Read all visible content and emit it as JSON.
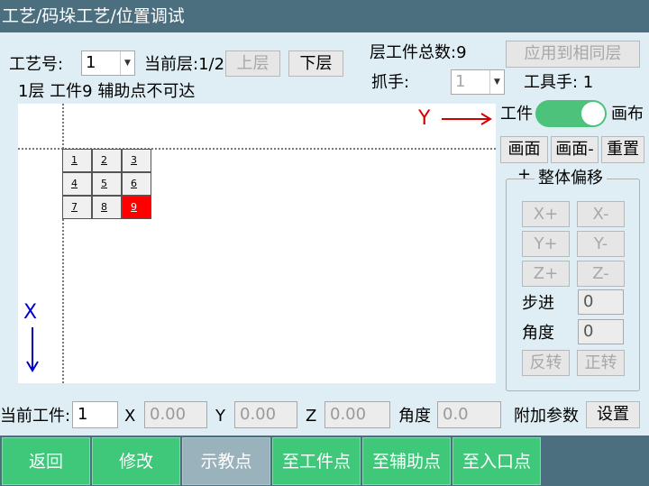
{
  "window": {
    "title": "工艺/码垛工艺/位置调试"
  },
  "header": {
    "process_label": "工艺号:",
    "process_value": "1",
    "current_layer_label": "当前层:1/2",
    "layer_up": "上层",
    "layer_down": "下层",
    "total_label": "层工件总数:9",
    "apply_same_layer": "应用到相同层",
    "gripper_label": "抓手:",
    "gripper_value": "1",
    "tool_label": "工具手: 1",
    "status_text": "1层 工件9 辅助点不可达"
  },
  "canvas": {
    "y_axis_label": "Y",
    "x_axis_label": "X",
    "cells": [
      {
        "label": "1",
        "selected": false
      },
      {
        "label": "2",
        "selected": false
      },
      {
        "label": "3",
        "selected": false
      },
      {
        "label": "4",
        "selected": false
      },
      {
        "label": "5",
        "selected": false
      },
      {
        "label": "6",
        "selected": false
      },
      {
        "label": "7",
        "selected": false
      },
      {
        "label": "8",
        "selected": false
      },
      {
        "label": "9",
        "selected": true
      }
    ]
  },
  "side": {
    "toggle_left": "工件",
    "toggle_right": "画布",
    "toggle_on": true,
    "zoom_in": "画面+",
    "zoom_out": "画面-",
    "reset": "重置",
    "offset_title": "整体偏移",
    "x_plus": "X+",
    "x_minus": "X-",
    "y_plus": "Y+",
    "y_minus": "Y-",
    "z_plus": "Z+",
    "z_minus": "Z-",
    "step_label": "步进",
    "step_value": "0",
    "angle_label": "角度",
    "angle_value": "0",
    "reverse": "反转",
    "forward": "正转"
  },
  "bottom_fields": {
    "current_label": "当前工件:",
    "current_value": "1",
    "x_label": "X",
    "x_value": "0.00",
    "y_label": "Y",
    "y_value": "0.00",
    "z_label": "Z",
    "z_value": "0.00",
    "angle_label": "角度",
    "angle_value": "0.0",
    "extra_label": "附加参数",
    "settings": "设置"
  },
  "nav": {
    "back": "返回",
    "modify": "修改",
    "teach": "示教点",
    "to_workpiece": "至工件点",
    "to_aux": "至辅助点",
    "to_entry": "至入口点"
  },
  "colors": {
    "title_bar": "#4c6f80",
    "background": "#dfeef4",
    "nav_green": "#3fc77a",
    "selected_cell": "#ff0000",
    "toggle_on": "#4cc27a"
  }
}
